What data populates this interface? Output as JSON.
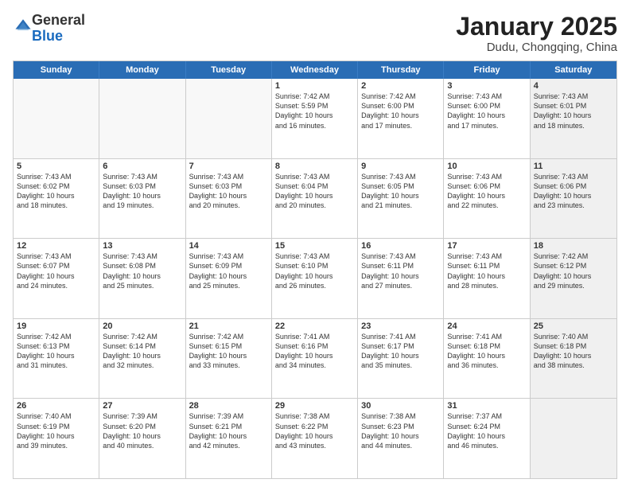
{
  "logo": {
    "general": "General",
    "blue": "Blue"
  },
  "title": {
    "month": "January 2025",
    "location": "Dudu, Chongqing, China"
  },
  "header": {
    "days": [
      "Sunday",
      "Monday",
      "Tuesday",
      "Wednesday",
      "Thursday",
      "Friday",
      "Saturday"
    ]
  },
  "rows": [
    [
      {
        "day": "",
        "text": "",
        "empty": true
      },
      {
        "day": "",
        "text": "",
        "empty": true
      },
      {
        "day": "",
        "text": "",
        "empty": true
      },
      {
        "day": "1",
        "text": "Sunrise: 7:42 AM\nSunset: 5:59 PM\nDaylight: 10 hours\nand 16 minutes."
      },
      {
        "day": "2",
        "text": "Sunrise: 7:42 AM\nSunset: 6:00 PM\nDaylight: 10 hours\nand 17 minutes."
      },
      {
        "day": "3",
        "text": "Sunrise: 7:43 AM\nSunset: 6:00 PM\nDaylight: 10 hours\nand 17 minutes."
      },
      {
        "day": "4",
        "text": "Sunrise: 7:43 AM\nSunset: 6:01 PM\nDaylight: 10 hours\nand 18 minutes.",
        "shaded": true
      }
    ],
    [
      {
        "day": "5",
        "text": "Sunrise: 7:43 AM\nSunset: 6:02 PM\nDaylight: 10 hours\nand 18 minutes."
      },
      {
        "day": "6",
        "text": "Sunrise: 7:43 AM\nSunset: 6:03 PM\nDaylight: 10 hours\nand 19 minutes."
      },
      {
        "day": "7",
        "text": "Sunrise: 7:43 AM\nSunset: 6:03 PM\nDaylight: 10 hours\nand 20 minutes."
      },
      {
        "day": "8",
        "text": "Sunrise: 7:43 AM\nSunset: 6:04 PM\nDaylight: 10 hours\nand 20 minutes."
      },
      {
        "day": "9",
        "text": "Sunrise: 7:43 AM\nSunset: 6:05 PM\nDaylight: 10 hours\nand 21 minutes."
      },
      {
        "day": "10",
        "text": "Sunrise: 7:43 AM\nSunset: 6:06 PM\nDaylight: 10 hours\nand 22 minutes."
      },
      {
        "day": "11",
        "text": "Sunrise: 7:43 AM\nSunset: 6:06 PM\nDaylight: 10 hours\nand 23 minutes.",
        "shaded": true
      }
    ],
    [
      {
        "day": "12",
        "text": "Sunrise: 7:43 AM\nSunset: 6:07 PM\nDaylight: 10 hours\nand 24 minutes."
      },
      {
        "day": "13",
        "text": "Sunrise: 7:43 AM\nSunset: 6:08 PM\nDaylight: 10 hours\nand 25 minutes."
      },
      {
        "day": "14",
        "text": "Sunrise: 7:43 AM\nSunset: 6:09 PM\nDaylight: 10 hours\nand 25 minutes."
      },
      {
        "day": "15",
        "text": "Sunrise: 7:43 AM\nSunset: 6:10 PM\nDaylight: 10 hours\nand 26 minutes."
      },
      {
        "day": "16",
        "text": "Sunrise: 7:43 AM\nSunset: 6:11 PM\nDaylight: 10 hours\nand 27 minutes."
      },
      {
        "day": "17",
        "text": "Sunrise: 7:43 AM\nSunset: 6:11 PM\nDaylight: 10 hours\nand 28 minutes."
      },
      {
        "day": "18",
        "text": "Sunrise: 7:42 AM\nSunset: 6:12 PM\nDaylight: 10 hours\nand 29 minutes.",
        "shaded": true
      }
    ],
    [
      {
        "day": "19",
        "text": "Sunrise: 7:42 AM\nSunset: 6:13 PM\nDaylight: 10 hours\nand 31 minutes."
      },
      {
        "day": "20",
        "text": "Sunrise: 7:42 AM\nSunset: 6:14 PM\nDaylight: 10 hours\nand 32 minutes."
      },
      {
        "day": "21",
        "text": "Sunrise: 7:42 AM\nSunset: 6:15 PM\nDaylight: 10 hours\nand 33 minutes."
      },
      {
        "day": "22",
        "text": "Sunrise: 7:41 AM\nSunset: 6:16 PM\nDaylight: 10 hours\nand 34 minutes."
      },
      {
        "day": "23",
        "text": "Sunrise: 7:41 AM\nSunset: 6:17 PM\nDaylight: 10 hours\nand 35 minutes."
      },
      {
        "day": "24",
        "text": "Sunrise: 7:41 AM\nSunset: 6:18 PM\nDaylight: 10 hours\nand 36 minutes."
      },
      {
        "day": "25",
        "text": "Sunrise: 7:40 AM\nSunset: 6:18 PM\nDaylight: 10 hours\nand 38 minutes.",
        "shaded": true
      }
    ],
    [
      {
        "day": "26",
        "text": "Sunrise: 7:40 AM\nSunset: 6:19 PM\nDaylight: 10 hours\nand 39 minutes."
      },
      {
        "day": "27",
        "text": "Sunrise: 7:39 AM\nSunset: 6:20 PM\nDaylight: 10 hours\nand 40 minutes."
      },
      {
        "day": "28",
        "text": "Sunrise: 7:39 AM\nSunset: 6:21 PM\nDaylight: 10 hours\nand 42 minutes."
      },
      {
        "day": "29",
        "text": "Sunrise: 7:38 AM\nSunset: 6:22 PM\nDaylight: 10 hours\nand 43 minutes."
      },
      {
        "day": "30",
        "text": "Sunrise: 7:38 AM\nSunset: 6:23 PM\nDaylight: 10 hours\nand 44 minutes."
      },
      {
        "day": "31",
        "text": "Sunrise: 7:37 AM\nSunset: 6:24 PM\nDaylight: 10 hours\nand 46 minutes."
      },
      {
        "day": "",
        "text": "",
        "empty": true,
        "shaded": true
      }
    ]
  ]
}
